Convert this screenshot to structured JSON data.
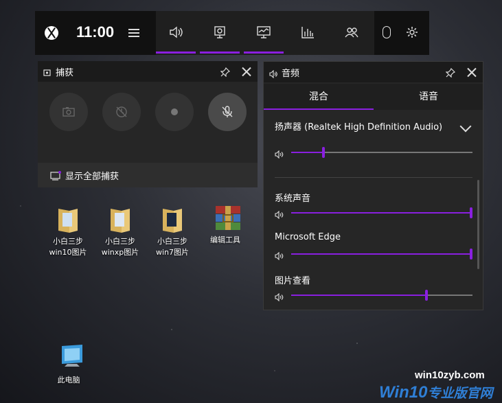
{
  "gamebar": {
    "clock": "11:00",
    "icons": [
      "xbox-logo",
      "menu-icon",
      "audio-icon",
      "capture-icon",
      "performance-icon",
      "resources-icon",
      "social-icon",
      "mouse-icon",
      "settings-icon"
    ]
  },
  "capture_panel": {
    "title": "捕获",
    "footer_label": "显示全部捕获",
    "buttons": [
      "camera-icon",
      "record-last-icon",
      "record-icon",
      "mic-off-icon"
    ]
  },
  "audio_panel": {
    "title": "音频",
    "tabs": [
      {
        "label": "混合"
      },
      {
        "label": "语音"
      }
    ],
    "device": "扬声器 (Realtek High Definition Audio)",
    "master_level": 0.17,
    "apps": [
      {
        "label": "系统声音",
        "level": 1.0
      },
      {
        "label": "Microsoft Edge",
        "level": 1.0
      },
      {
        "label": "图片查看",
        "level": 0.74
      }
    ]
  },
  "desktop": {
    "icons": [
      {
        "label": "小白三步\nwin10图片"
      },
      {
        "label": "小白三步\nwinxp图片"
      },
      {
        "label": "小白三步\nwin7图片"
      },
      {
        "label": "编辑工具"
      },
      {
        "label": "此电脑"
      }
    ]
  },
  "watermark": {
    "domain": "win10zyb.com",
    "brand": "Win10",
    "brand_suffix": "专业版官网"
  },
  "colors": {
    "accent": "#8a1fe0",
    "panel": "#262626"
  }
}
